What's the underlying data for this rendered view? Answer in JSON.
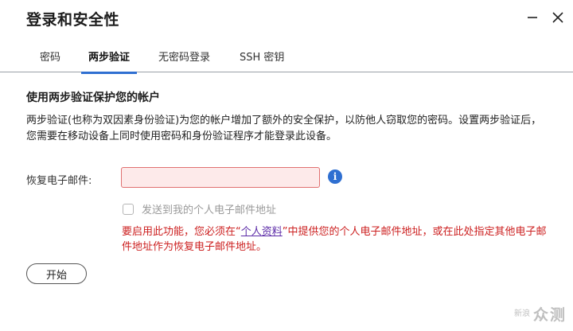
{
  "dialog": {
    "title": "登录和安全性"
  },
  "tabs": [
    {
      "label": "密码",
      "active": false
    },
    {
      "label": "两步验证",
      "active": true
    },
    {
      "label": "无密码登录",
      "active": false
    },
    {
      "label": "SSH 密钥",
      "active": false
    }
  ],
  "section": {
    "title": "使用两步验证保护您的帐户",
    "description": "两步验证(也称为双因素身份验证)为您的帐户增加了额外的安全保护，以防他人窃取您的密码。设置两步验证后，您需要在移动设备上同时使用密码和身份验证程序才能登录此设备。"
  },
  "form": {
    "email_label": "恢复电子邮件:",
    "email_value": "",
    "checkbox_label": "发送到我的个人电子邮件地址",
    "checkbox_checked": false
  },
  "warning": {
    "prefix": "要启用此功能，您必须在“",
    "link": "个人资料",
    "suffix": "”中提供您的个人电子邮件地址，或在此处指定其他电子邮件地址作为恢复电子邮件地址。"
  },
  "actions": {
    "start_label": "开始"
  },
  "watermark": {
    "badge": "新浪",
    "text": "众测"
  },
  "colors": {
    "accent": "#2f6fd1",
    "error": "#cc1f1f",
    "input_error_bg": "#fdeaea",
    "link": "#5b2aa7"
  }
}
